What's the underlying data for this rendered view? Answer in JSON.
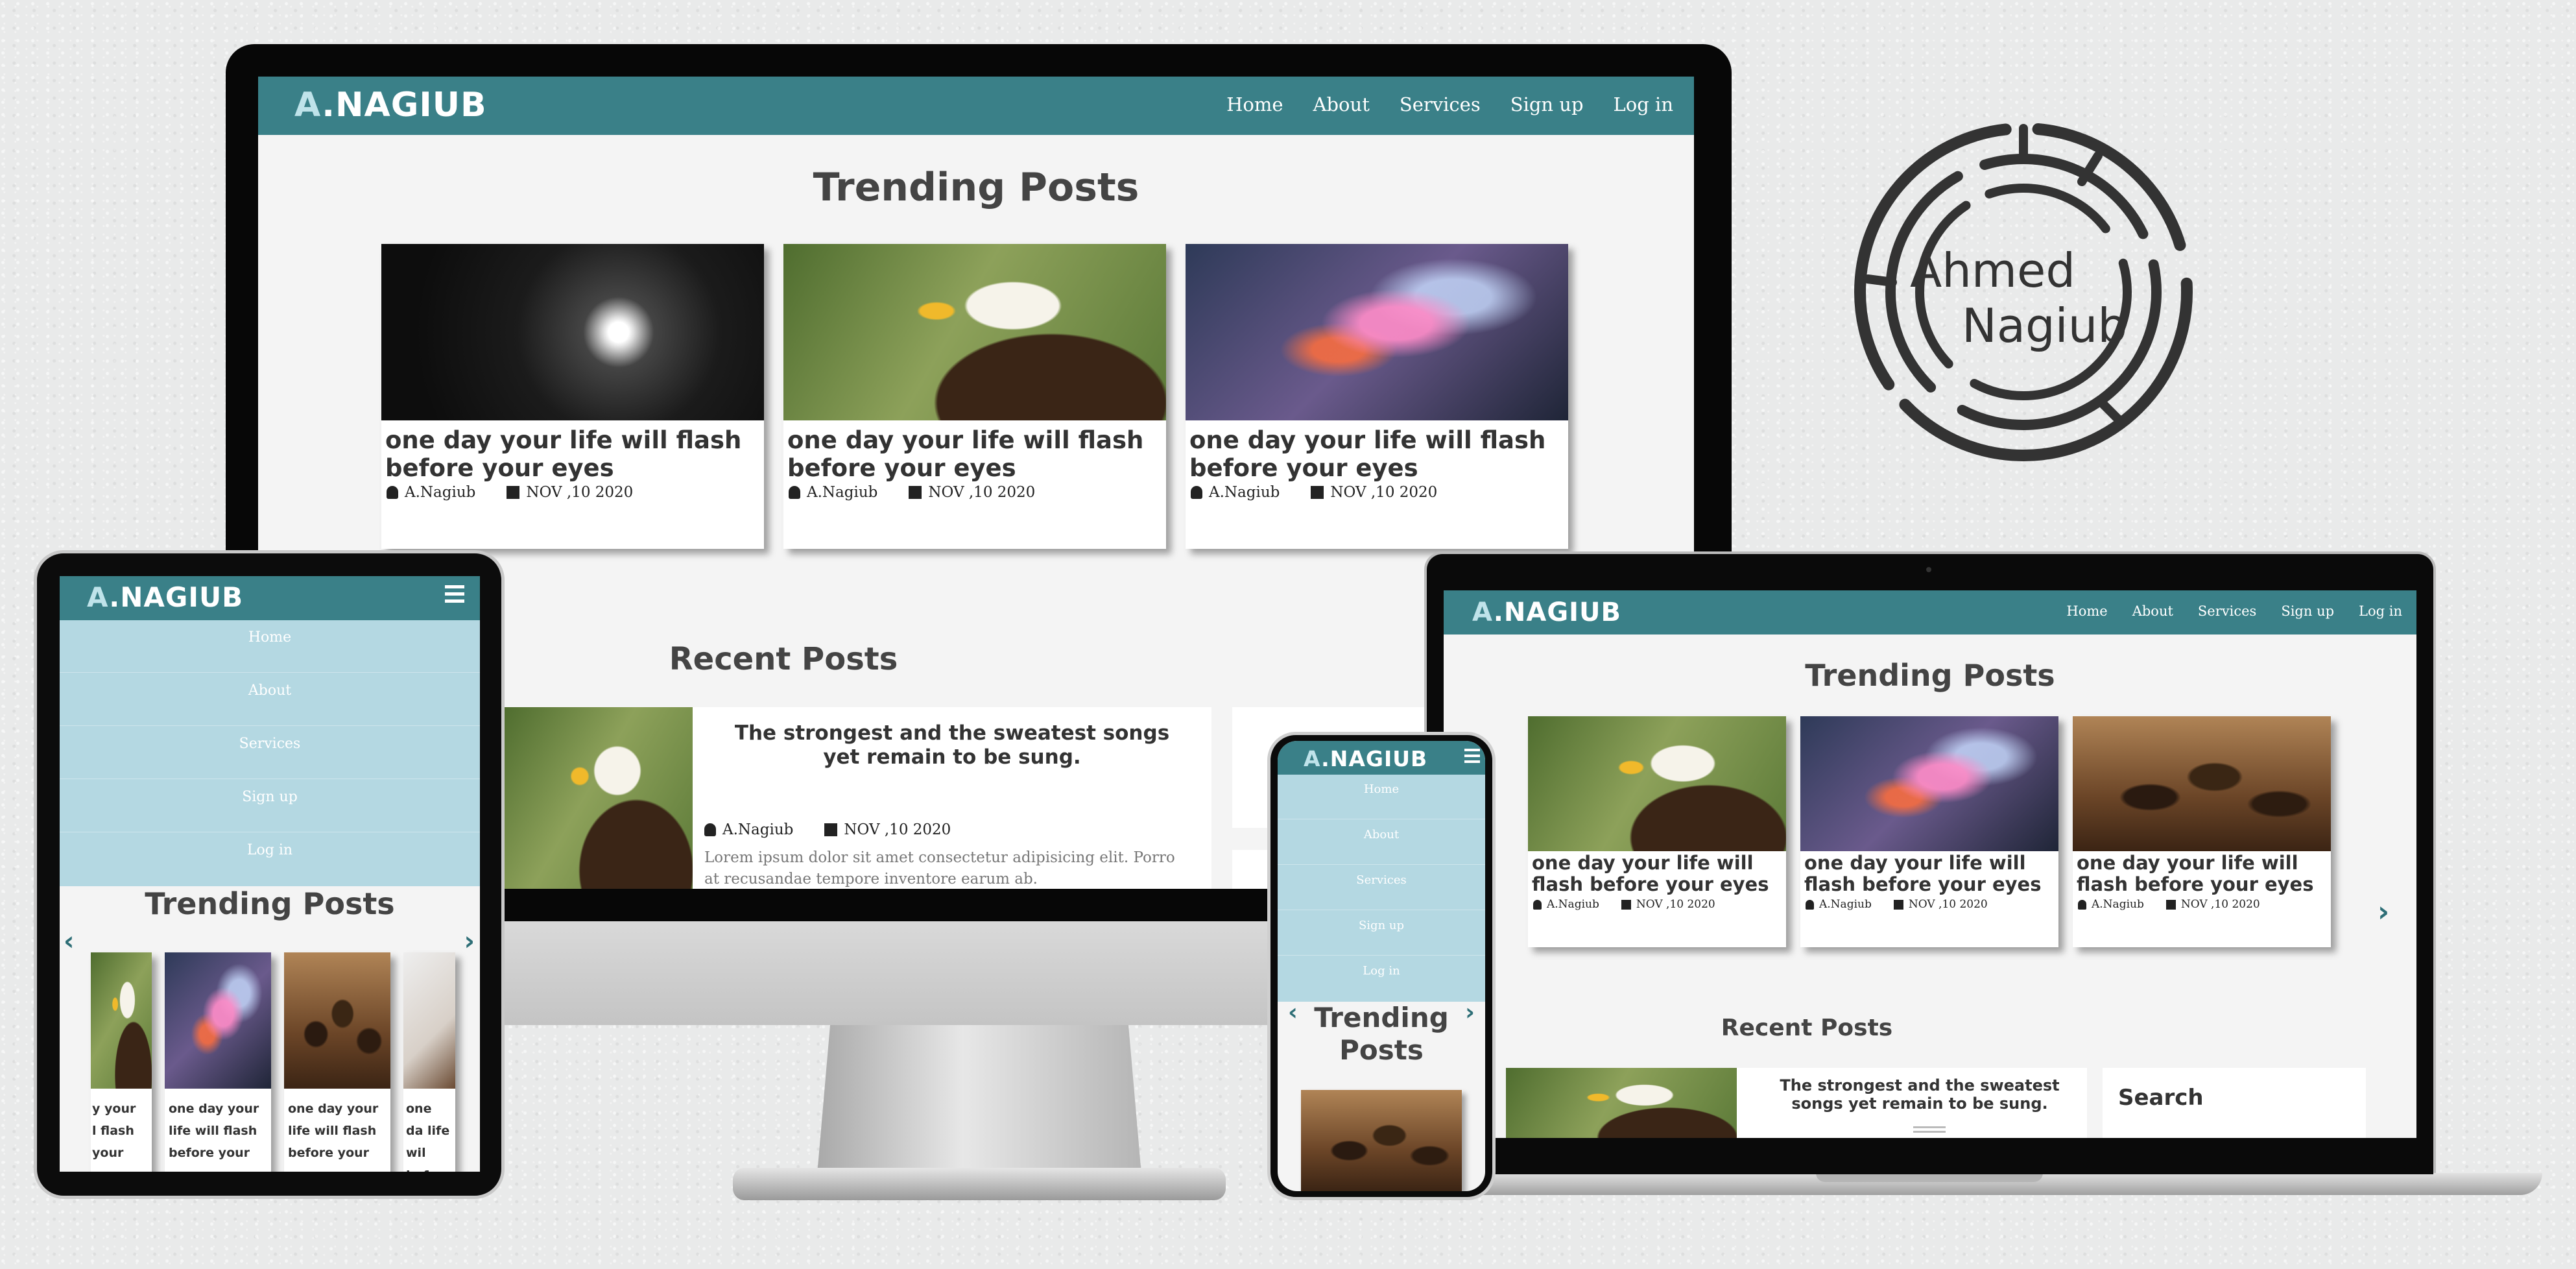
{
  "brand": {
    "prefix": "A",
    "dot": ".",
    "name": "NAGIUB"
  },
  "nav": {
    "home": "Home",
    "about": "About",
    "services": "Services",
    "signup": "Sign up",
    "login": "Log in"
  },
  "trending_title": "Trending Posts",
  "recent_title": "Recent Posts",
  "post": {
    "title": "one day your life will flash before your eyes",
    "author": "A.Nagiub",
    "date": "NOV ,10 2020"
  },
  "recent": {
    "title": "The strongest and the sweatest songs yet remain to be sung.",
    "author": "A.Nagiub",
    "date": "NOV ,10 2020",
    "excerpt": "Lorem ipsum dolor sit amet consectetur adipisicing elit. Porro at recusandae tempore inventore earum ab."
  },
  "sidebar": {
    "search": "Search"
  },
  "tablet_cards": {
    "c1": "y your l flash your",
    "c2": "one day your life will flash before your eyes",
    "c3": "one day your life will flash before your eyes",
    "c4": "one da life wil before"
  },
  "logo": {
    "line1": "Ahmed",
    "line2": "Nagiub"
  },
  "colors": {
    "accent": "#3a8088",
    "menu": "#b4d8e2"
  }
}
